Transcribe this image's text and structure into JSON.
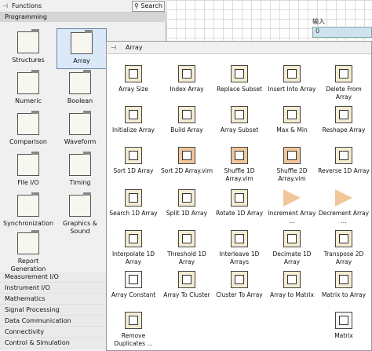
{
  "window": {
    "title": "Functions",
    "search_label": "Search",
    "category": "Programming"
  },
  "background": {
    "input_label": "输入",
    "input_value": "0"
  },
  "palette_items": [
    {
      "label": "Structures"
    },
    {
      "label": "Array"
    },
    {
      "label": "Numeric"
    },
    {
      "label": "Boolean"
    },
    {
      "label": "Comparison"
    },
    {
      "label": "Waveform"
    },
    {
      "label": "File I/O"
    },
    {
      "label": "Timing"
    },
    {
      "label": "Synchronization"
    },
    {
      "label": "Graphics & Sound"
    },
    {
      "label": "Report Generation"
    }
  ],
  "subcategories": [
    "Measurement I/O",
    "Instrument I/O",
    "Mathematics",
    "Signal Processing",
    "Data Communication",
    "Connectivity",
    "Control & Simulation"
  ],
  "array_palette": {
    "title": "Array",
    "functions": [
      {
        "label": "Array Size"
      },
      {
        "label": "Index Array"
      },
      {
        "label": "Replace Subset"
      },
      {
        "label": "Insert Into Array"
      },
      {
        "label": "Delete From Array"
      },
      {
        "label": "Initialize Array"
      },
      {
        "label": "Build Array"
      },
      {
        "label": "Array Subset"
      },
      {
        "label": "Max & Min"
      },
      {
        "label": "Reshape Array"
      },
      {
        "label": "Sort 1D Array"
      },
      {
        "label": "Sort 2D Array.vim"
      },
      {
        "label": "Shuffle 1D Array.vim"
      },
      {
        "label": "Shuffle 2D Array.vim"
      },
      {
        "label": "Reverse 1D Array"
      },
      {
        "label": "Search 1D Array"
      },
      {
        "label": "Split 1D Array"
      },
      {
        "label": "Rotate 1D Array"
      },
      {
        "label": "Increment Array ..."
      },
      {
        "label": "Decrement Array ..."
      },
      {
        "label": "Interpolate 1D Array"
      },
      {
        "label": "Threshold 1D Array"
      },
      {
        "label": "Interleave 1D Arrays"
      },
      {
        "label": "Decimate 1D Array"
      },
      {
        "label": "Transpose 2D Array"
      },
      {
        "label": "Array Constant"
      },
      {
        "label": "Array To Cluster"
      },
      {
        "label": "Cluster To Array"
      },
      {
        "label": "Array to Matrix"
      },
      {
        "label": "Matrix to Array"
      },
      {
        "label": "Remove Duplicates ..."
      },
      {
        "label": "Matrix"
      }
    ]
  }
}
